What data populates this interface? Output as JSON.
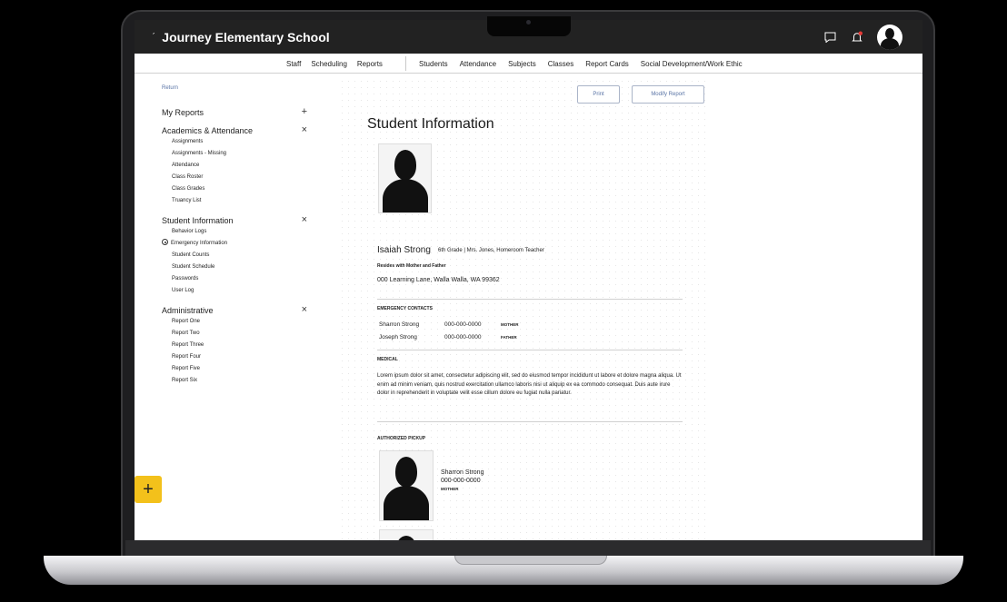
{
  "app": {
    "school_name": "Journey Elementary School"
  },
  "nav": {
    "left": [
      "Staff",
      "Scheduling",
      "Reports"
    ],
    "right": [
      "Students",
      "Attendance",
      "Subjects",
      "Classes",
      "Report Cards",
      "Social Development/Work Ethic"
    ]
  },
  "sidebar": {
    "return_label": "Return",
    "my_reports": {
      "title": "My Reports",
      "ctrl": "+"
    },
    "groups": [
      {
        "title": "Academics & Attendance",
        "ctrl": "×",
        "items": [
          "Assignments",
          "Assignments - Missing",
          "Attendance",
          "Class Roster",
          "Class Grades",
          "Truancy List"
        ]
      },
      {
        "title": "Student Information",
        "ctrl": "×",
        "items": [
          "Behavior Logs",
          "Emergency Information",
          "Student Counts",
          "Student Schedule",
          "Passwords",
          "User Log"
        ]
      },
      {
        "title": "Administrative",
        "ctrl": "×",
        "items": [
          "Report One",
          "Report Two",
          "Report Three",
          "Report Four",
          "Report Five",
          "Report Six"
        ]
      }
    ],
    "active_item": "Emergency Information",
    "fab_label": "+"
  },
  "report": {
    "print_label": "Print",
    "modify_label": "Modify Report",
    "title": "Student Information",
    "student_name": "Isaiah Strong",
    "student_meta": "6th Grade | Mrs. Jones, Homeroom Teacher",
    "resides_label": "Resides with Mother and Father",
    "address": "000 Learning Lane, Walla Walla, WA 99362",
    "emergency_label": "EMERGENCY CONTACTS",
    "contacts": [
      {
        "name": "Sharron Strong",
        "phone": "000-000-0000",
        "relation": "MOTHER"
      },
      {
        "name": "Joseph Strong",
        "phone": "000-000-0000",
        "relation": "FATHER"
      }
    ],
    "medical_label": "MEDICAL",
    "medical_text": "Lorem ipsum dolor sit amet, consectetur adipiscing elit, sed do eiusmod tempor incididunt ut labore et dolore magna aliqua. Ut enim ad minim veniam, quis nostrud exercitation ullamco laboris nisi ut aliquip ex ea commodo consequat. Duis aute irure dolor in reprehenderit in voluptate velit esse cillum dolore eu fugiat nulla pariatur.",
    "pickup_label": "AUTHORIZED PICKUP",
    "pickup": {
      "name": "Sharron Strong",
      "phone": "000-000-0000",
      "relation": "MOTHER"
    }
  },
  "colors": {
    "appbar": "#222222",
    "accent_link": "#5a74a6",
    "fab": "#f3c11b",
    "notification": "#e53935"
  }
}
